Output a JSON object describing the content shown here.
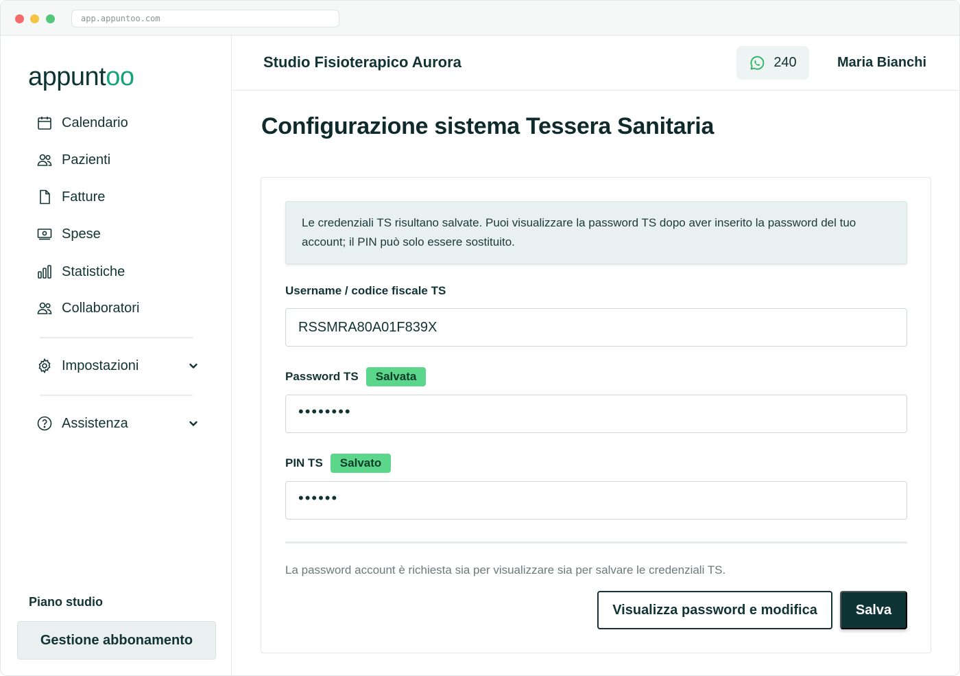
{
  "browser": {
    "url": "app.appuntoo.com"
  },
  "logo": {
    "prefix": "appunt",
    "suffix": "oo"
  },
  "sidebar": {
    "items": [
      {
        "label": "Calendario",
        "icon": "calendar-icon"
      },
      {
        "label": "Pazienti",
        "icon": "users-icon"
      },
      {
        "label": "Fatture",
        "icon": "file-icon"
      },
      {
        "label": "Spese",
        "icon": "money-icon"
      },
      {
        "label": "Statistiche",
        "icon": "bar-chart-icon"
      },
      {
        "label": "Collaboratori",
        "icon": "users-icon"
      }
    ],
    "settings": {
      "label": "Impostazioni",
      "icon": "gear-icon"
    },
    "support": {
      "label": "Assistenza",
      "icon": "help-circle-icon"
    },
    "plan_label": "Piano studio",
    "plan_button": "Gestione abbonamento"
  },
  "header": {
    "studio_name": "Studio Fisioterapico Aurora",
    "whatsapp_count": "240",
    "user_name": "Maria Bianchi"
  },
  "page": {
    "title": "Configurazione sistema Tessera Sanitaria",
    "info_text": "Le credenziali TS risultano salvate. Puoi visualizzare la password TS dopo aver inserito la password del tuo account; il PIN può solo essere sostituito.",
    "username_label": "Username / codice fiscale TS",
    "username_value": "RSSMRA80A01F839X",
    "password_label": "Password TS",
    "password_badge": "Salvata",
    "password_value": "••••••••",
    "pin_label": "PIN TS",
    "pin_badge": "Salvato",
    "pin_value": "••••••",
    "hint": "La password account è richiesta sia per visualizzare sia per salvare le credenziali TS.",
    "view_button": "Visualizza password e modifica",
    "save_button": "Salva"
  },
  "colors": {
    "brand_dark": "#0f3436",
    "brand_accent": "#16a37b",
    "badge_green": "#5bd68a",
    "whatsapp_green": "#25b35c"
  }
}
